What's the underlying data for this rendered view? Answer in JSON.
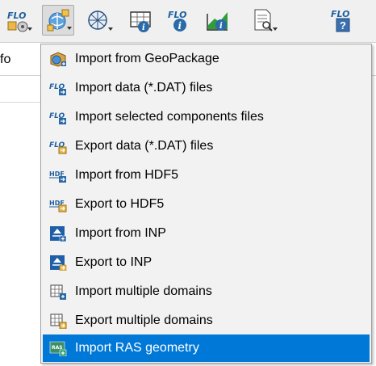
{
  "toolbar": {
    "buttons": [
      {
        "icon": "flo-setup-icon",
        "has_dropdown": true
      },
      {
        "icon": "import-export-icon",
        "has_dropdown": true,
        "active": true
      },
      {
        "icon": "globe-grid-icon",
        "has_dropdown": true
      },
      {
        "icon": "map-info-icon",
        "has_dropdown": false
      },
      {
        "icon": "flo-info-icon",
        "has_dropdown": false
      },
      {
        "icon": "profile-info-icon",
        "has_dropdown": false
      },
      {
        "icon": "document-search-icon",
        "has_dropdown": true
      },
      {
        "icon": "flo-help-icon",
        "has_dropdown": false
      }
    ]
  },
  "panel": {
    "label": "fo"
  },
  "menu": {
    "items": [
      {
        "label": "Import from GeoPackage",
        "icon": "geopackage-icon"
      },
      {
        "label": "Import data (*.DAT) files",
        "icon": "flo-import-icon"
      },
      {
        "label": "Import selected components files",
        "icon": "flo-import-selected-icon"
      },
      {
        "label": "Export data (*.DAT) files",
        "icon": "flo-export-icon"
      },
      {
        "label": "Import from HDF5",
        "icon": "hdf5-import-icon"
      },
      {
        "label": "Export to HDF5",
        "icon": "hdf5-export-icon"
      },
      {
        "label": "Import from INP",
        "icon": "inp-import-icon"
      },
      {
        "label": "Export to INP",
        "icon": "inp-export-icon"
      },
      {
        "label": "Import multiple domains",
        "icon": "domains-import-icon"
      },
      {
        "label": "Export multiple domains",
        "icon": "domains-export-icon"
      },
      {
        "label": "Import RAS geometry",
        "icon": "ras-import-icon",
        "selected": true
      }
    ]
  },
  "colors": {
    "selection": "#0078d7",
    "flo_blue": "#1f5f9f",
    "menu_background": "#f2f2f2"
  }
}
